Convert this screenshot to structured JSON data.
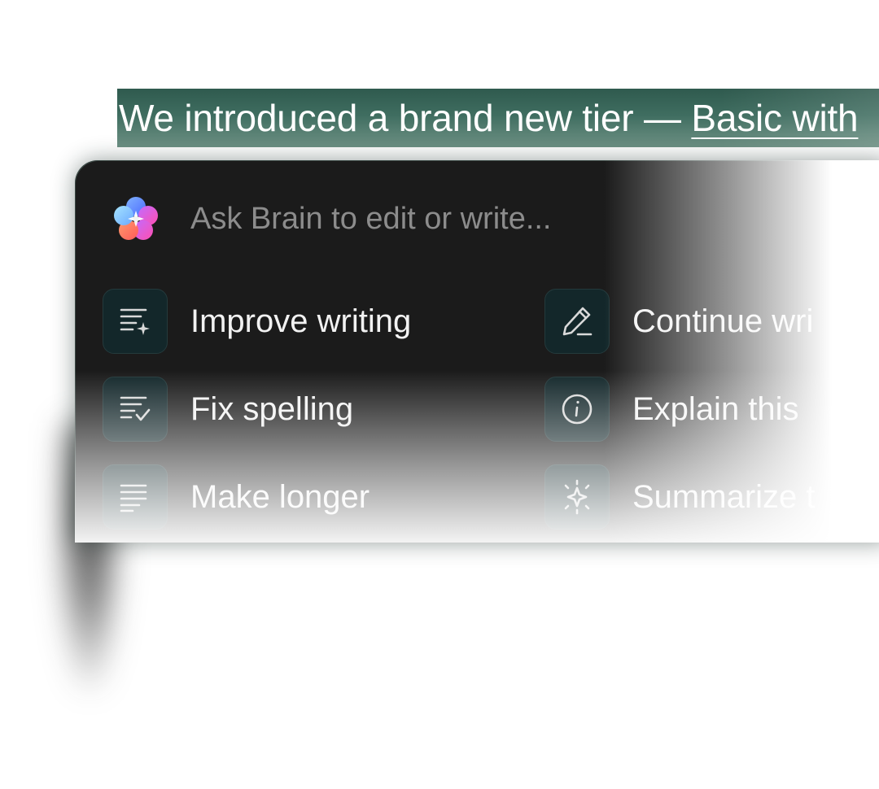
{
  "selection": {
    "text_plain": "We introduced a brand new tier — ",
    "text_link": "Basic with"
  },
  "ai_panel": {
    "prompt_placeholder": "Ask Brain to edit or write...",
    "actions": [
      {
        "label": "Improve writing",
        "icon": "improve-writing-icon"
      },
      {
        "label": "Continue wri",
        "icon": "pencil-icon"
      },
      {
        "label": "Fix spelling",
        "icon": "spellcheck-icon"
      },
      {
        "label": "Explain this",
        "icon": "info-icon"
      },
      {
        "label": "Make longer",
        "icon": "lines-icon"
      },
      {
        "label": "Summarize t",
        "icon": "sparkle-icon"
      }
    ]
  },
  "colors": {
    "selection_bg": "#3f6d60",
    "panel_bg": "#1b1b1b",
    "tile_bg": "#13272a",
    "text_light": "#f2f2f2"
  }
}
